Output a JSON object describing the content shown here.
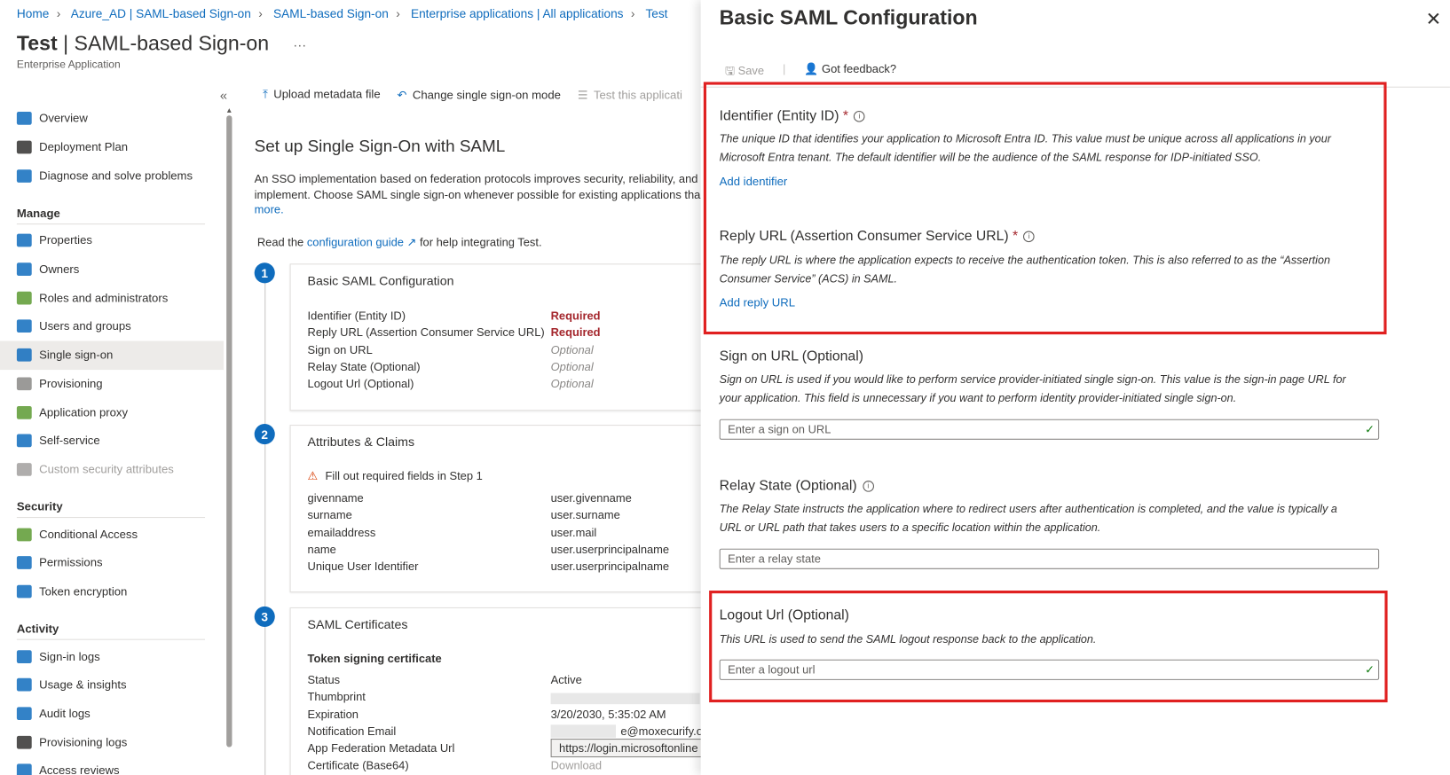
{
  "breadcrumb": [
    "Home",
    "Azure_AD | SAML-based Sign-on",
    "SAML-based Sign-on",
    "Enterprise applications | All applications",
    "Test"
  ],
  "header": {
    "title_bold": "Test",
    "title_rest": " | SAML-based Sign-on",
    "more": "···",
    "subtitle": "Enterprise Application",
    "collapse": "«"
  },
  "nav": {
    "top": [
      {
        "label": "Overview",
        "color": "#0f6cbd"
      },
      {
        "label": "Deployment Plan",
        "color": "#323130"
      },
      {
        "label": "Diagnose and solve problems",
        "color": "#0f6cbd"
      }
    ],
    "manage_title": "Manage",
    "manage": [
      {
        "label": "Properties",
        "color": "#0f6cbd"
      },
      {
        "label": "Owners",
        "color": "#0f6cbd"
      },
      {
        "label": "Roles and administrators",
        "color": "#5c9a31"
      },
      {
        "label": "Users and groups",
        "color": "#0f6cbd"
      },
      {
        "label": "Single sign-on",
        "color": "#0f6cbd",
        "selected": true
      },
      {
        "label": "Provisioning",
        "color": "#8a8886"
      },
      {
        "label": "Application proxy",
        "color": "#5c9a31"
      },
      {
        "label": "Self-service",
        "color": "#0f6cbd"
      },
      {
        "label": "Custom security attributes",
        "color": "#a19f9d",
        "disabled": true
      }
    ],
    "security_title": "Security",
    "security": [
      {
        "label": "Conditional Access",
        "color": "#5c9a31"
      },
      {
        "label": "Permissions",
        "color": "#0f6cbd"
      },
      {
        "label": "Token encryption",
        "color": "#0f6cbd"
      }
    ],
    "activity_title": "Activity",
    "activity": [
      {
        "label": "Sign-in logs",
        "color": "#0f6cbd"
      },
      {
        "label": "Usage & insights",
        "color": "#0f6cbd"
      },
      {
        "label": "Audit logs",
        "color": "#0f6cbd"
      },
      {
        "label": "Provisioning logs",
        "color": "#323130"
      },
      {
        "label": "Access reviews",
        "color": "#0f6cbd"
      }
    ]
  },
  "toolbar": {
    "upload": "Upload metadata file",
    "change": "Change single sign-on mode",
    "test": "Test this applicati"
  },
  "main": {
    "heading": "Set up Single Sign-On with SAML",
    "para1": "An SSO implementation based on federation protocols improves security, reliability, and",
    "para2": "implement. Choose SAML single sign-on whenever possible for existing applications tha",
    "para3": "more.",
    "read_pre": "Read the ",
    "read_link": "configuration guide",
    "read_post": " for help integrating Test.",
    "step1": {
      "num": "1",
      "title": "Basic SAML Configuration",
      "rows": [
        [
          "Identifier (Entity ID)",
          "Required"
        ],
        [
          "Reply URL (Assertion Consumer Service URL)",
          "Required"
        ],
        [
          "Sign on URL",
          "Optional"
        ],
        [
          "Relay State (Optional)",
          "Optional"
        ],
        [
          "Logout Url (Optional)",
          "Optional"
        ]
      ]
    },
    "step2": {
      "num": "2",
      "title": "Attributes & Claims",
      "warning": "Fill out required fields in Step 1",
      "rows": [
        [
          "givenname",
          "user.givenname"
        ],
        [
          "surname",
          "user.surname"
        ],
        [
          "emailaddress",
          "user.mail"
        ],
        [
          "name",
          "user.userprincipalname"
        ],
        [
          "Unique User Identifier",
          "user.userprincipalname"
        ]
      ]
    },
    "step3": {
      "num": "3",
      "title": "SAML Certificates",
      "subtitle": "Token signing certificate",
      "rows": [
        [
          "Status",
          "Active"
        ],
        [
          "Thumbprint",
          ""
        ],
        [
          "Expiration",
          "3/20/2030, 5:35:02 AM"
        ],
        [
          "Notification Email",
          "e@moxecurify.or"
        ],
        [
          "App Federation Metadata Url",
          "https://login.microsoftonline"
        ],
        [
          "Certificate (Base64)",
          "Download"
        ]
      ]
    }
  },
  "panel": {
    "title": "Basic SAML Configuration",
    "save": "Save",
    "feedback": "Got feedback?",
    "identifier": {
      "label": "Identifier (Entity ID)",
      "star": " *",
      "desc": "The unique ID that identifies your application to Microsoft Entra ID. This value must be unique across all applications in your Microsoft Entra tenant. The default identifier will be the audience of the SAML response for IDP-initiated SSO.",
      "link": "Add identifier"
    },
    "reply": {
      "label": "Reply URL (Assertion Consumer Service URL)",
      "star": " *",
      "desc": "The reply URL is where the application expects to receive the authentication token. This is also referred to as the “Assertion Consumer Service” (ACS) in SAML.",
      "link": "Add reply URL"
    },
    "signon": {
      "label": "Sign on URL (Optional)",
      "desc": "Sign on URL is used if you would like to perform service provider-initiated single sign-on. This value is the sign-in page URL for your application. This field is unnecessary if you want to perform identity provider-initiated single sign-on.",
      "placeholder": "Enter a sign on URL"
    },
    "relay": {
      "label": "Relay State (Optional)",
      "desc": "The Relay State instructs the application where to redirect users after authentication is completed, and the value is typically a URL or URL path that takes users to a specific location within the application.",
      "placeholder": "Enter a relay state"
    },
    "logout": {
      "label": "Logout Url (Optional)",
      "desc": "This URL is used to send the SAML logout response back to the application.",
      "placeholder": "Enter a logout url"
    }
  }
}
